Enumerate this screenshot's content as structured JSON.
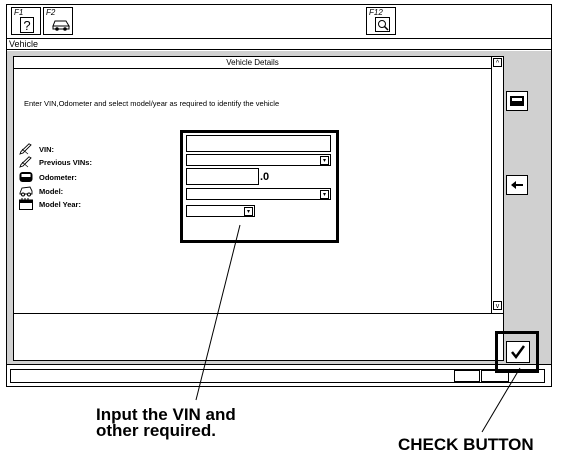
{
  "toolbar": {
    "f1_label": "F1",
    "f2_label": "F2",
    "f12_label": "F12"
  },
  "window": {
    "title": "Vehicle"
  },
  "panel": {
    "title": "Vehicle Details",
    "instructions": "Enter VIN,Odometer and select model/year as required to identify the vehicle"
  },
  "form": {
    "vin_label": "VIN:",
    "previous_vins_label": "Previous VINs:",
    "odometer_label": "Odometer:",
    "odometer_suffix": ".0",
    "model_label": "Model:",
    "model_year_label": "Model Year:"
  },
  "scroll": {
    "up": "^",
    "down": "v"
  },
  "dropdown_glyph": "▾",
  "callouts": {
    "input_hint_line1": "Input the VIN and",
    "input_hint_line2": "other required.",
    "check_button": "CHECK BUTTON"
  },
  "icons": {
    "f1": "help-icon",
    "f2": "vehicle-icon",
    "f12": "search-icon",
    "vin": "pen-icon",
    "previous_vins": "pen-icon",
    "odometer": "odometer-icon",
    "model": "car-icon",
    "model_year": "calendar-icon",
    "side_top": "tablet-icon",
    "side_mid": "back-arrow-icon",
    "check": "checkmark-icon"
  }
}
